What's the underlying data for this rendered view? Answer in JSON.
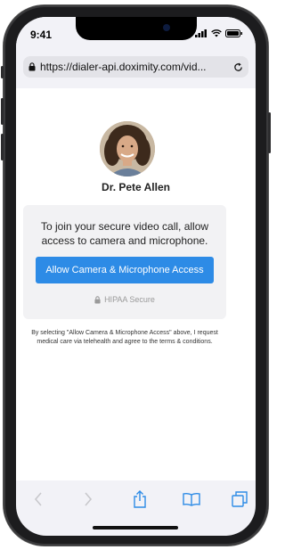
{
  "status_bar": {
    "time": "9:41"
  },
  "browser": {
    "url": "https://dialer-api.doximity.com/vid..."
  },
  "doctor": {
    "name": "Dr. Pete Allen"
  },
  "card": {
    "message": "To join your secure video call, allow access to camera and microphone.",
    "allow_button_label": "Allow Camera & Microphone Access",
    "secure_label": "HIPAA Secure"
  },
  "consent_text": "By selecting \"Allow Camera & Microphone Access\" above, I request medical care via telehealth and agree to the terms & conditions.",
  "toolbar": {
    "icons": [
      "chevron-left-icon",
      "chevron-right-icon",
      "share-icon",
      "bookmarks-icon",
      "tabs-icon"
    ]
  },
  "colors": {
    "accent": "#2d8be6",
    "text": "#222222",
    "muted": "#9a9a9a"
  }
}
